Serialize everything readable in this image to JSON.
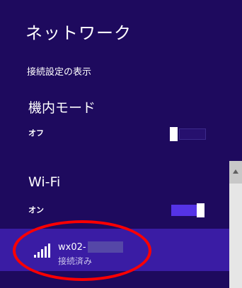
{
  "header": {
    "title": "ネットワーク",
    "settings_link": "接続設定の表示"
  },
  "airplane_mode": {
    "label": "機内モード",
    "state": "オフ"
  },
  "wifi": {
    "label": "Wi-Fi",
    "state": "オン"
  },
  "network": {
    "name": "wx02-",
    "status": "接続済み",
    "signal_bars": 5
  },
  "colors": {
    "background": "#1e0a5e",
    "selected_row": "#3a1ca4",
    "toggle_on": "#5533e6",
    "annotation": "#ff0000"
  },
  "icons": {
    "signal": "wifi-signal-icon",
    "scroll_up": "chevron-up-icon"
  }
}
